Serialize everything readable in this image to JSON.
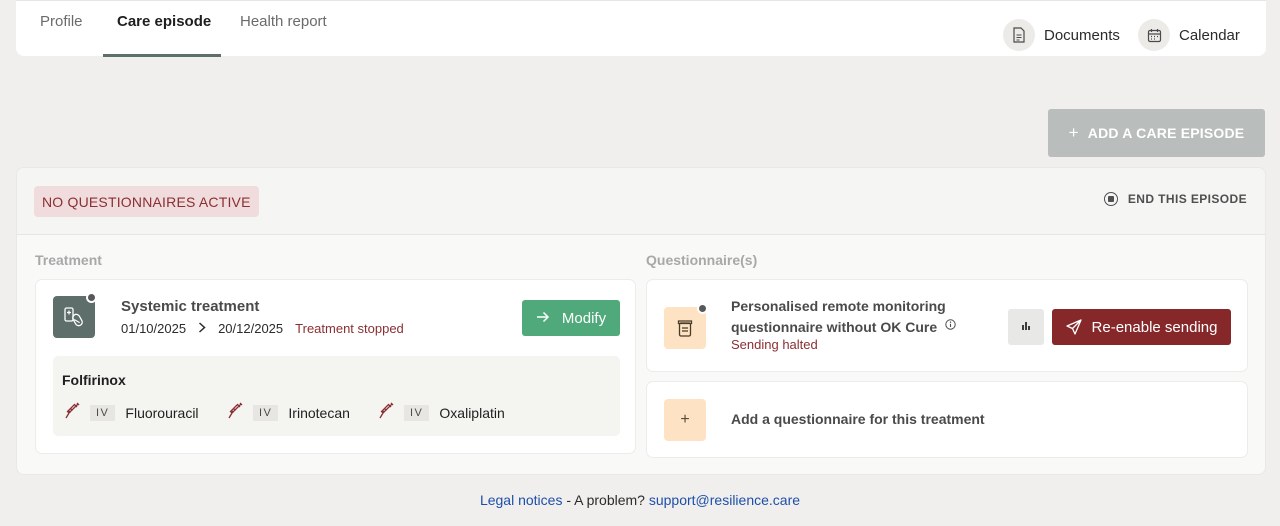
{
  "tabs": [
    {
      "label": "Profile",
      "active": false
    },
    {
      "label": "Care episode",
      "active": true
    },
    {
      "label": "Health report",
      "active": false
    }
  ],
  "toolbar": {
    "documents_label": "Documents",
    "calendar_label": "Calendar"
  },
  "actions": {
    "add_episode_label": "ADD A CARE EPISODE",
    "add_episode_icon": "plus-icon"
  },
  "episode": {
    "status_badge": "NO QUESTIONNAIRES ACTIVE",
    "end_label": "END THIS EPISODE",
    "treatment_section_label": "Treatment",
    "questionnaire_section_label": "Questionnaire(s)",
    "treatment": {
      "title": "Systemic treatment",
      "start_date": "01/10/2025",
      "end_date": "20/12/2025",
      "status": "Treatment stopped",
      "modify_label": "Modify",
      "protocol": "Folfirinox",
      "drugs": [
        {
          "route": "IV",
          "name": "Fluorouracil"
        },
        {
          "route": "IV",
          "name": "Irinotecan"
        },
        {
          "route": "IV",
          "name": "Oxaliplatin"
        }
      ]
    },
    "questionnaire": {
      "title": "Personalised remote monitoring questionnaire without OK Cure",
      "status": "Sending halted",
      "reenable_label": "Re-enable sending"
    },
    "add_questionnaire_label": "Add a questionnaire for this treatment",
    "add_questionnaire_symbol": "+"
  },
  "footer": {
    "legal_label": "Legal notices",
    "problem_text": " - A problem? ",
    "support_email": "support@resilience.care"
  },
  "colors": {
    "accent_green": "#4fa97a",
    "danger_red": "#86272a",
    "slate": "#5d6e6b",
    "questionnaire_bg": "#fde3c3"
  }
}
